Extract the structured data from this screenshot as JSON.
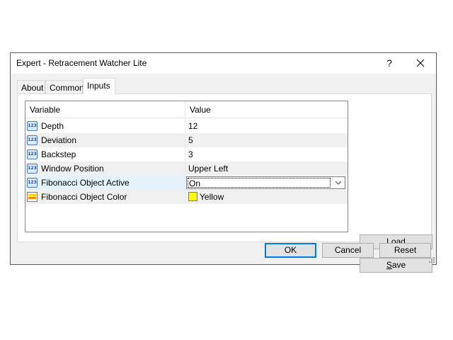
{
  "dialog": {
    "title": "Expert - Retracement Watcher Lite",
    "help_label": "?",
    "close_label": "✕"
  },
  "tabs": [
    {
      "label": "About",
      "active": false
    },
    {
      "label": "Common",
      "active": false
    },
    {
      "label": "Inputs",
      "active": true
    }
  ],
  "grid": {
    "columns": [
      "Variable",
      "Value"
    ],
    "rows": [
      {
        "icon": "number-type-icon",
        "icon_text": "123",
        "variable": "Depth",
        "value": "12"
      },
      {
        "icon": "number-type-icon",
        "icon_text": "123",
        "variable": "Deviation",
        "value": "5"
      },
      {
        "icon": "number-type-icon",
        "icon_text": "123",
        "variable": "Backstep",
        "value": "3"
      },
      {
        "icon": "number-type-icon",
        "icon_text": "123",
        "variable": "Window Position",
        "value": "Upper Left"
      },
      {
        "icon": "number-type-icon",
        "icon_text": "123",
        "variable": "Fibonacci Object Active",
        "value": "On"
      },
      {
        "icon": "color-type-icon",
        "variable": "Fibonacci Object Color",
        "value": "Yellow",
        "swatch_color": "#ffff00"
      }
    ]
  },
  "buttons": {
    "load_first": "L",
    "load_rest": "oad",
    "save_first": "S",
    "save_rest": "ave",
    "ok": "OK",
    "cancel": "Cancel",
    "reset": "Reset"
  },
  "colors": {
    "selection": "#e5f1fb",
    "default_button_border": "#0078d7"
  }
}
